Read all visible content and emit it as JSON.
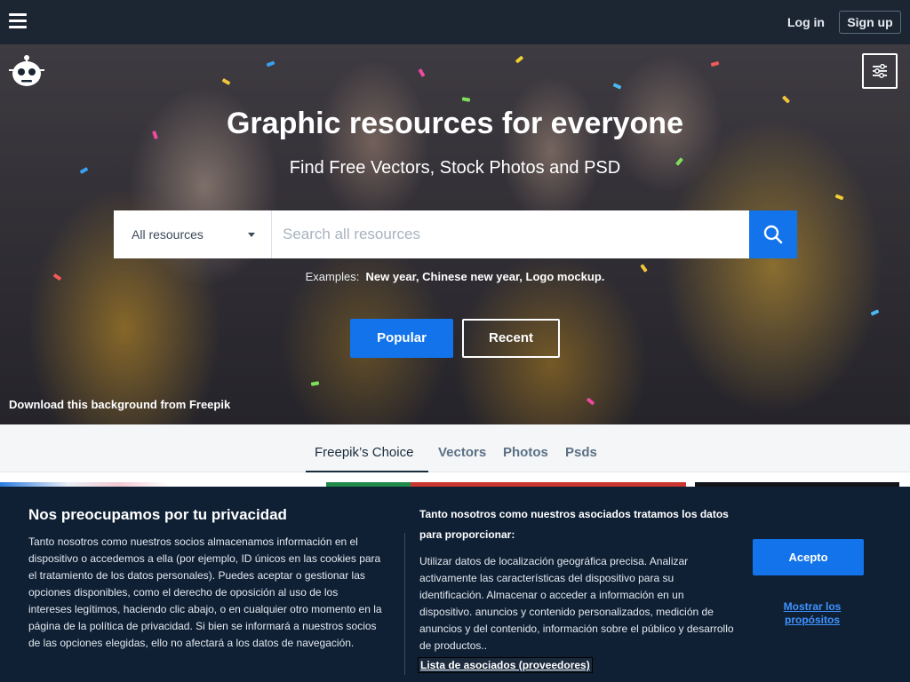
{
  "topbar": {
    "login_label": "Log in",
    "signup_label": "Sign up",
    "menu_icon": "hamburger-menu-icon"
  },
  "hero": {
    "logo_icon": "freepik-logo-icon",
    "filter_icon": "sliders-icon",
    "title": "Graphic resources for everyone",
    "subtitle": "Find Free Vectors, Stock Photos and PSD",
    "search": {
      "category_label": "All resources",
      "placeholder": "Search all resources",
      "button_icon": "search-icon"
    },
    "examples_label": "Examples:",
    "examples": [
      "New year",
      "Chinese new year",
      "Logo mockup"
    ],
    "popular_label": "Popular",
    "recent_label": "Recent",
    "download_bg_label": "Download this background from Freepik"
  },
  "tabs": [
    {
      "label": "Freepik’s Choice",
      "active": true
    },
    {
      "label": "Vectors",
      "active": false
    },
    {
      "label": "Photos",
      "active": false
    },
    {
      "label": "Psds",
      "active": false
    }
  ],
  "cookie": {
    "title": "Nos preocupamos por tu privacidad",
    "text": "Tanto nosotros como nuestros socios almacenamos información en el dispositivo o accedemos a ella (por ejemplo, ID únicos en las cookies para el tratamiento de los datos personales). Puedes aceptar o gestionar las opciones disponibles, como el derecho de oposición al uso de los intereses legítimos, haciendo clic abajo, o en cualquier otro momento en la página de la política de privacidad. Si bien se informará a nuestros socios de las opciones elegidas, ello no afectará a los datos de navegación.",
    "right_title": "Tanto nosotros como nuestros asociados tratamos los datos para proporcionar:",
    "right_text": "Utilizar datos de localización geográfica precisa. Analizar activamente las características del dispositivo para su identificación. Almacenar o acceder a información en un dispositivo. anuncios y contenido personalizados, medición de anuncios y del contenido, información sobre el público y desarrollo de productos..",
    "partners_label": "Lista de asociados (proveedores)",
    "accept_label": "Acepto",
    "show_purposes_label": "Mostrar los propósitos"
  },
  "colors": {
    "accent": "#1273eb",
    "topbar_bg": "#1c2633",
    "cookie_bg": "#0f2035"
  }
}
